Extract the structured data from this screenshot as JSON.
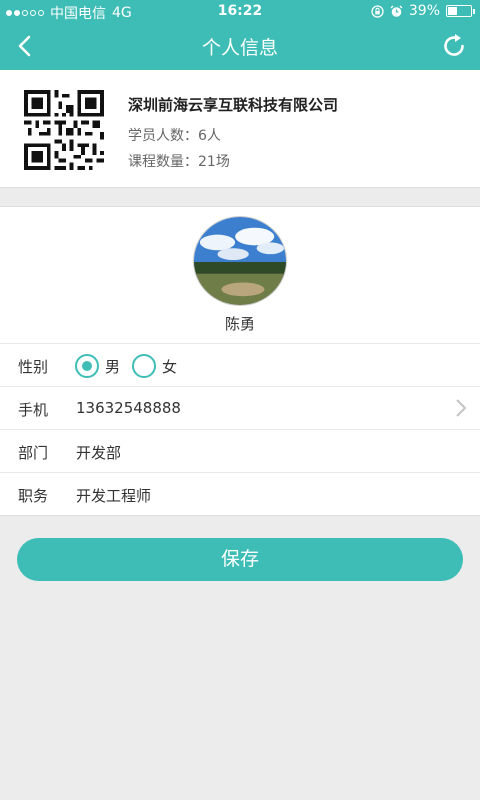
{
  "status_bar": {
    "carrier": "中国电信",
    "network": "4G",
    "time": "16:22",
    "battery_text": "39%",
    "battery_level": 0.39
  },
  "nav": {
    "title": "个人信息"
  },
  "company": {
    "name": "深圳前海云享互联科技有限公司",
    "students": "学员人数：6人",
    "courses": "课程数量：21场"
  },
  "profile": {
    "name": "陈勇"
  },
  "form": {
    "gender_label": "性别",
    "gender_options": [
      "男",
      "女"
    ],
    "gender_selected": "男",
    "phone_label": "手机",
    "phone_value": "13632548888",
    "department_label": "部门",
    "department_value": "开发部",
    "position_label": "职务",
    "position_value": "开发工程师"
  },
  "save_label": "保存",
  "colors": {
    "accent": "#3dbdb5",
    "background": "#ececec"
  }
}
